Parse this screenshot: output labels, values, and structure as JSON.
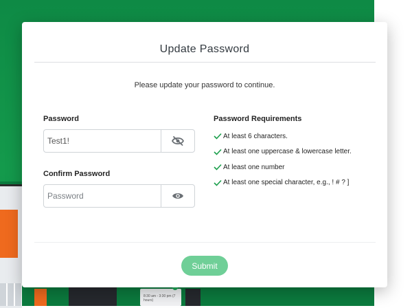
{
  "modal": {
    "title": "Update Password",
    "subtitle": "Please update your password to continue.",
    "password": {
      "label": "Password",
      "value": "Test1!",
      "placeholder": "Password",
      "visibility_icon": "eye-slash-icon"
    },
    "confirm_password": {
      "label": "Confirm Password",
      "value": "",
      "placeholder": "Password",
      "visibility_icon": "eye-icon"
    },
    "requirements": {
      "title": "Password Requirements",
      "items": [
        "At least 6 characters.",
        "At least one uppercase & lowercase letter.",
        "At least one number",
        "At least one special character, e.g., ! # ? ]"
      ],
      "check_color": "#1a9e4b"
    },
    "submit_label": "Submit",
    "submit_color": "#6fcf97"
  },
  "background": {
    "accent": "#149a4c",
    "card_text": "8:30 am - 3:30 pm (7 hours)"
  }
}
